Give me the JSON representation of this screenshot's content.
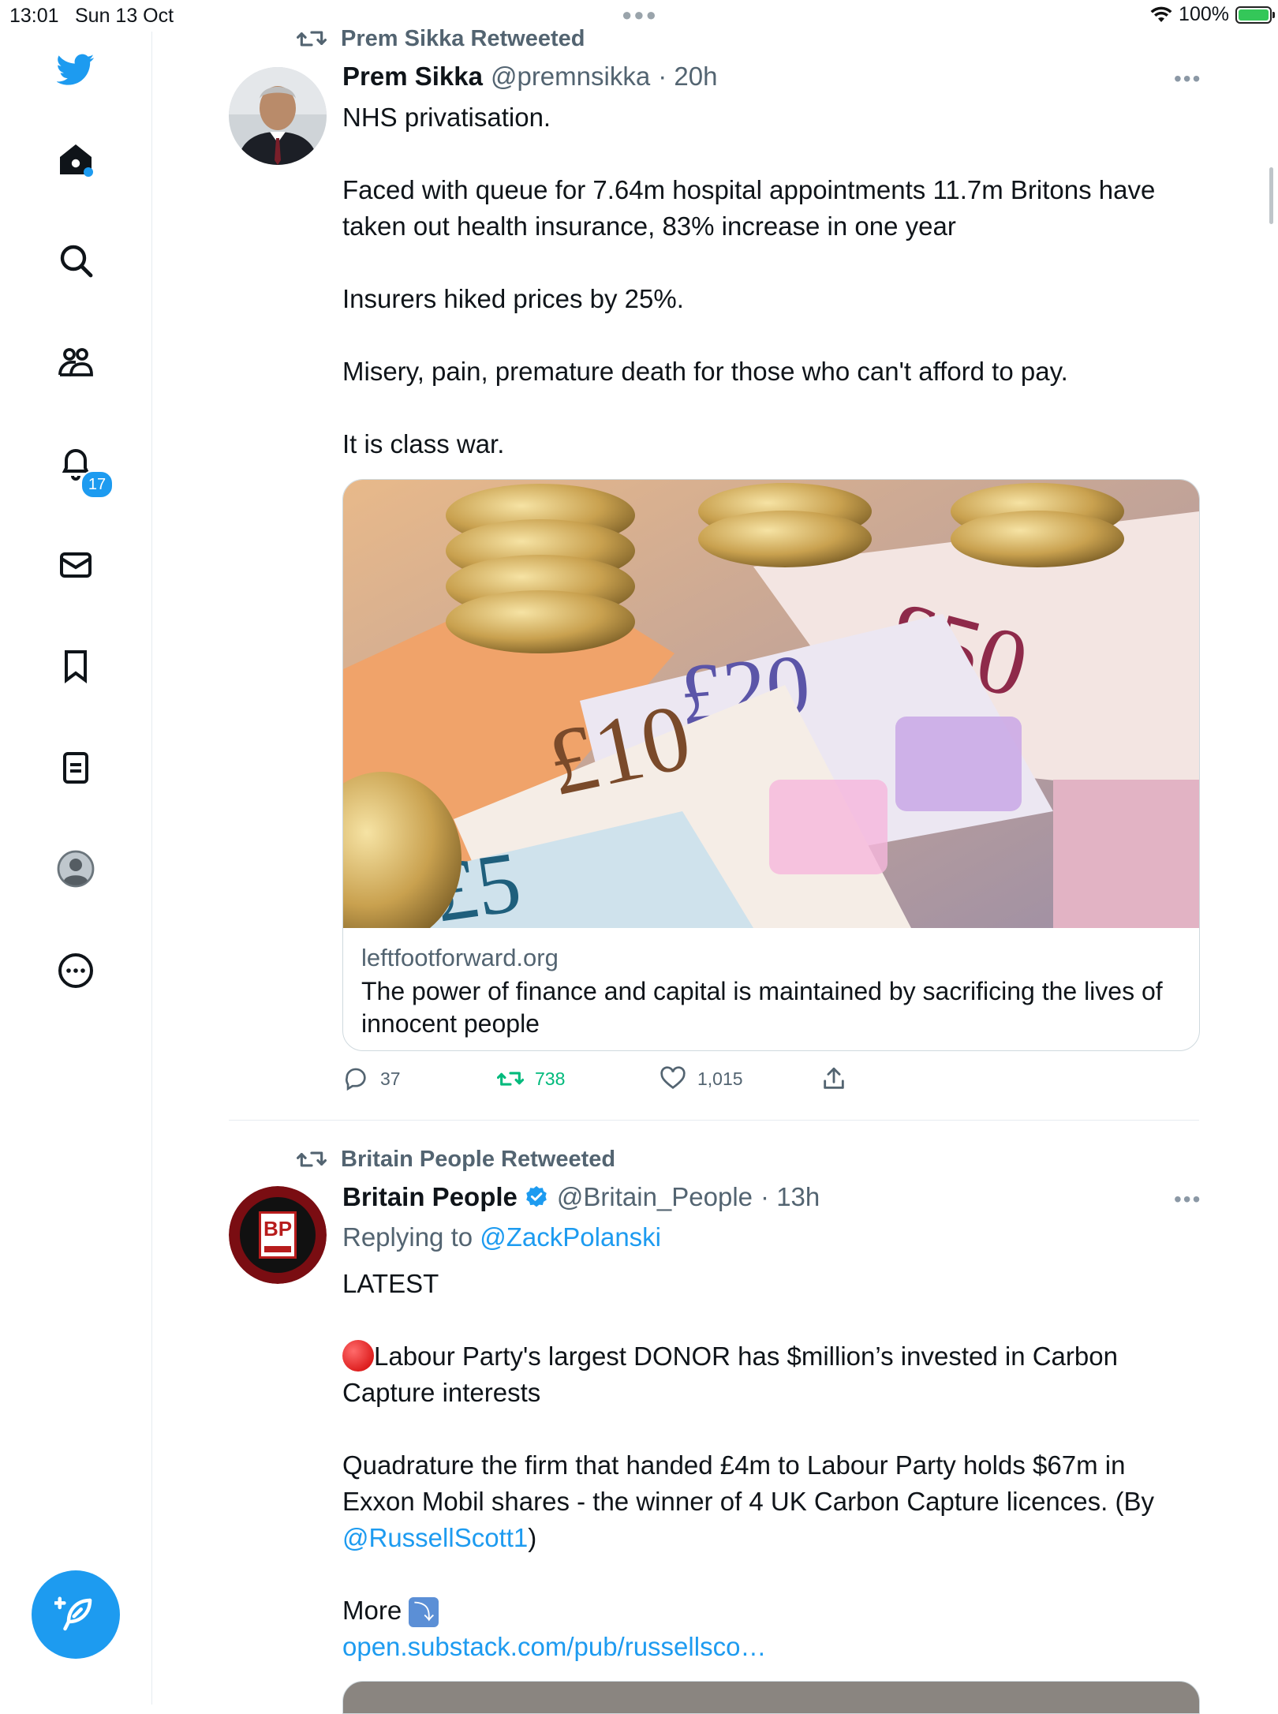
{
  "status_bar": {
    "time": "13:01",
    "date": "Sun 13 Oct",
    "battery": "100%"
  },
  "sidebar": {
    "notification_count": "17"
  },
  "tweet1": {
    "retweeted_by": "Prem Sikka Retweeted",
    "name": "Prem Sikka",
    "handle": "@premnsikka",
    "time": "· 20h",
    "paragraphs": [
      "NHS privatisation.",
      "Faced with queue for 7.64m hospital appointments 11.7m Britons have taken out health insurance, 83% increase in one year",
      "Insurers hiked prices by 25%.",
      "Misery, pain, premature death for those who can't afford to pay.",
      "It is class war."
    ],
    "card": {
      "domain": "leftfootforward.org",
      "title": "The power of finance and capital is maintained by sacrificing the lives of innocent people"
    },
    "replies": "37",
    "retweets": "738",
    "likes": "1,015"
  },
  "tweet2": {
    "retweeted_by": "Britain People Retweeted",
    "name": "Britain People",
    "handle": "@Britain_People",
    "time": "· 13h",
    "replying_prefix": "Replying to ",
    "replying_to": "@ZackPolanski",
    "p1": "LATEST",
    "p2": "Labour Party's largest DONOR has $million’s invested in Carbon Capture interests",
    "p3": "Quadrature the firm that handed £4m to Labour Party holds $67m in Exxon Mobil shares - the winner of 4 UK Carbon Capture licences. (By ",
    "p3_mention": "@RussellScott1",
    "p3_end": ")",
    "p4": "More ",
    "p4_emoji": "⤵",
    "p5_link": "open.substack.com/pub/russellsco…"
  },
  "colors": {
    "accent": "#1d9bf0",
    "retweet_green": "#00ba7c",
    "muted": "#536471"
  }
}
